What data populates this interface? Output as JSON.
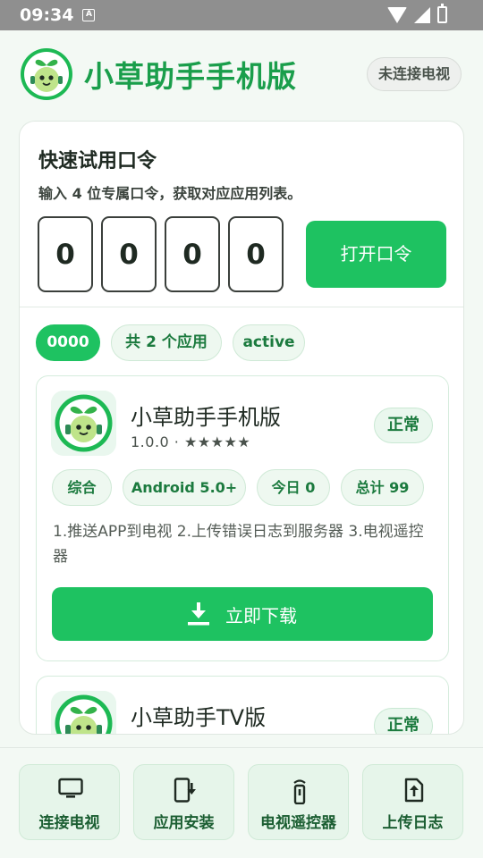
{
  "status_bar": {
    "time": "09:34",
    "a_icon": "A"
  },
  "header": {
    "title": "小草助手手机版",
    "connection_status": "未连接电视"
  },
  "quick": {
    "title": "快速试用口令",
    "description": "输入 4 位专属口令，获取对应应用列表。",
    "digits": [
      "0",
      "0",
      "0",
      "0"
    ],
    "open_button": "打开口令"
  },
  "result_chips": {
    "code": "0000",
    "count": "共 2 个应用",
    "state": "active"
  },
  "apps": [
    {
      "name": "小草助手手机版",
      "meta": "1.0.0 · ★★★★★",
      "status": "正常",
      "tags": [
        "综合",
        "Android 5.0+",
        "今日 0",
        "总计 99"
      ],
      "description": "1.推送APP到电视   2.上传错误日志到服务器   3.电视遥控器",
      "download_label": "立即下载"
    },
    {
      "name": "小草助手TV版",
      "status": "正常"
    }
  ],
  "bottom_nav": [
    {
      "label": "连接电视",
      "icon": "tv-icon"
    },
    {
      "label": "应用安装",
      "icon": "phone-download-icon"
    },
    {
      "label": "电视遥控器",
      "icon": "remote-icon"
    },
    {
      "label": "上传日志",
      "icon": "file-upload-icon"
    }
  ],
  "colors": {
    "accent": "#1ec261",
    "brand_text": "#1a9e4b",
    "background": "#f3f9f4"
  }
}
